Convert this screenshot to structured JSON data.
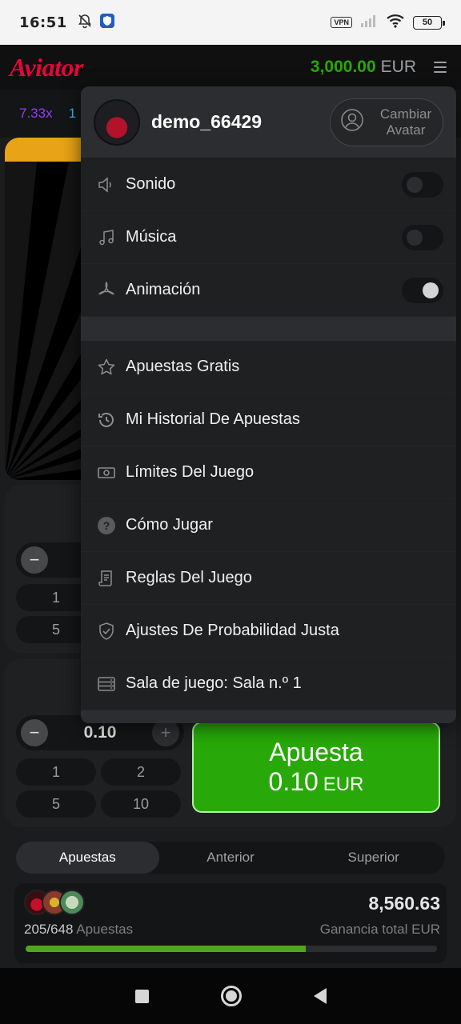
{
  "status_bar": {
    "time": "16:51",
    "vpn": "VPN",
    "battery": "50"
  },
  "header": {
    "logo": "Aviator",
    "balance_amount": "3,000.00",
    "balance_currency": "EUR"
  },
  "multipliers": [
    "7.33x",
    "1"
  ],
  "menu": {
    "username": "demo_66429",
    "change_avatar": "Cambiar Avatar",
    "settings": [
      {
        "label": "Sonido",
        "icon": "speaker-icon",
        "on": false
      },
      {
        "label": "Música",
        "icon": "music-note-icon",
        "on": false
      },
      {
        "label": "Animación",
        "icon": "propeller-icon",
        "on": true
      }
    ],
    "items": [
      {
        "label": "Apuestas Gratis",
        "icon": "star-icon"
      },
      {
        "label": "Mi Historial De Apuestas",
        "icon": "history-icon"
      },
      {
        "label": "Límites Del Juego",
        "icon": "money-icon"
      },
      {
        "label": "Cómo Jugar",
        "icon": "question-icon"
      },
      {
        "label": "Reglas Del Juego",
        "icon": "document-icon"
      },
      {
        "label": "Ajustes De Probabilidad Justa",
        "icon": "shield-check-icon"
      },
      {
        "label": "Sala de juego: Sala n.º 1",
        "icon": "server-icon"
      }
    ]
  },
  "bet_panel_top": {
    "chips": [
      "1",
      "5"
    ],
    "minus": "−"
  },
  "bet_panel": {
    "minus": "−",
    "plus": "+",
    "amount": "0.10",
    "chips": [
      "1",
      "2",
      "5",
      "10"
    ],
    "button_title": "Apuesta",
    "button_amount": "0.10",
    "button_currency": "EUR"
  },
  "bets": {
    "tabs": [
      "Apuestas",
      "Anterior",
      "Superior"
    ],
    "active_tab": "Apuestas",
    "total_win": "8,560.63",
    "count": "205/648",
    "count_label": "Apuestas",
    "total_label": "Ganancia total EUR",
    "progress": 0.68
  },
  "colors": {
    "accent_green": "#28a909",
    "logo_red": "#e50539",
    "menu_bg": "#1f2022"
  }
}
